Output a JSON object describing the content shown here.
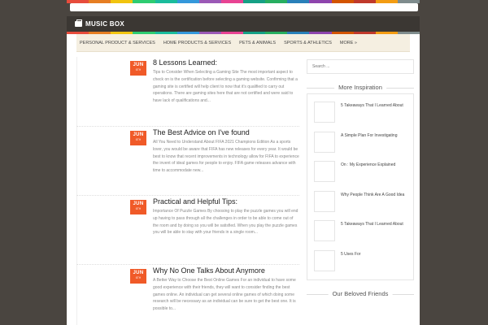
{
  "colors": {
    "accent": "#f05a28",
    "stripe": [
      "#e74c3c",
      "#e67e22",
      "#f1c40f",
      "#2ecc71",
      "#1abc9c",
      "#3498db",
      "#9b59b6",
      "#e84393",
      "#16a085",
      "#27ae60",
      "#2980b9",
      "#8e44ad",
      "#d35400",
      "#c0392b",
      "#f39c12",
      "#7f8c8d"
    ]
  },
  "header": {
    "site_title": "MUSIC BOX",
    "logo_icon": "briefcase-icon"
  },
  "nav": {
    "items": [
      {
        "label": "PERSONAL PRODUCT & SERVICES"
      },
      {
        "label": "HOME PRODUCTS & SERVICES"
      },
      {
        "label": "PETS & ANIMALS"
      },
      {
        "label": "SPORTS & ATHLETICS"
      },
      {
        "label": "MORE »"
      }
    ]
  },
  "posts": [
    {
      "month": "JUN",
      "day": "6TH",
      "title": "8 Lessons Learned:",
      "excerpt": "Tips to Consider When Selecting a Gaming Site The most important aspect to check on is the certification before selecting a gaming website. Confirming that a gaming site is certified will help client to now that it's qualified to carry out operations. There are gaming sites here that are not certified and were said to have lack of qualifications and..."
    },
    {
      "month": "JUN",
      "day": "6TH",
      "title": "The Best Advice on I've found",
      "excerpt": "All You Need to Understand About FIFA 2021 Champions Edition As a sports lover, you would be aware that FIFA has new releases for every year. It would be best to know that recent improvements in technology allow for FIFA to experience the invent of ideal games for people to enjoy. FIFA game releases advance with time to accommodate new..."
    },
    {
      "month": "JUN",
      "day": "6TH",
      "title": "Practical and Helpful Tips:",
      "excerpt": "Importance Of Puzzle Games By choosing to play the puzzle games you will end up having to pass through all the challenges in order to be able to come out of the room and by doing so you will be satisfied. When you play the puzzle games you will be able to stay with your friends in a single room..."
    },
    {
      "month": "JUN",
      "day": "6TH",
      "title": "Why No One Talks About Anymore",
      "excerpt": "A Better Way to Choose the Best Online Games For an individual to have some good experience with their friends, they will want to consider finding the best games online. An individual can get several online games of which doing some research will be necessary as an individual can be sure to get the best one. It is possible to..."
    }
  ],
  "sidebar": {
    "search_placeholder": "Search ...",
    "widget1_title": "More Inspiration",
    "recent": [
      {
        "title": "5 Takeaways That I Learned About"
      },
      {
        "title": "A Simple Plan For Investigating"
      },
      {
        "title": "On : My Experience Explained"
      },
      {
        "title": "Why People Think Are A Good Idea"
      },
      {
        "title": "5 Takeaways That I Learned About"
      },
      {
        "title": "5 Uses For"
      }
    ],
    "widget2_title": "Our Beloved Friends"
  }
}
